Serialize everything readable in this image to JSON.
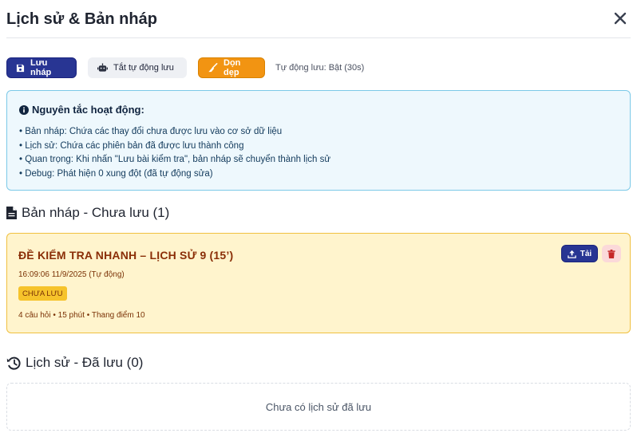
{
  "header": {
    "title": "Lịch sử & Bản nháp",
    "close_icon": "close-icon"
  },
  "toolbar": {
    "save_draft_label": "Lưu nháp",
    "save_draft_icon": "save-icon",
    "autosave_toggle_label": "Tắt tự động lưu",
    "autosave_toggle_icon": "robot-icon",
    "cleanup_label": "Dọn dẹp",
    "cleanup_icon": "broom-icon",
    "autosave_status": "Tự động lưu: Bật (30s)"
  },
  "info": {
    "title": "Nguyên tắc hoạt động:",
    "icon": "info-icon",
    "items": [
      "• Bản nháp: Chứa các thay đổi chưa được lưu vào cơ sở dữ liệu",
      "• Lịch sử: Chứa các phiên bản đã được lưu thành công",
      "• Quan trọng: Khi nhấn \"Lưu bài kiểm tra\", bản nháp sẽ chuyển thành lịch sử",
      "• Debug: Phát hiện 0 xung đột (đã tự động sửa)"
    ]
  },
  "drafts": {
    "heading": "Bản nháp - Chưa lưu (1)",
    "icon": "file-icon",
    "items": [
      {
        "title": "ĐỀ KIỂM TRA NHANH – LỊCH SỬ 9 (15’)",
        "time": "16:09:06 11/9/2025 (Tự động)",
        "badge": "CHƯA LƯU",
        "meta": "4 câu hỏi • 15 phút • Thang điểm 10",
        "load_label": "Tải",
        "load_icon": "upload-icon",
        "delete_icon": "trash-icon"
      }
    ]
  },
  "history": {
    "heading": "Lịch sử - Đã lưu (0)",
    "icon": "history-icon",
    "empty_text": "Chưa có lịch sử đã lưu"
  },
  "colors": {
    "primary": "#283593",
    "warning": "#f29412",
    "info_border": "#7cc9e8",
    "draft_bg": "#fff4cd",
    "draft_title": "#8a2e07"
  }
}
